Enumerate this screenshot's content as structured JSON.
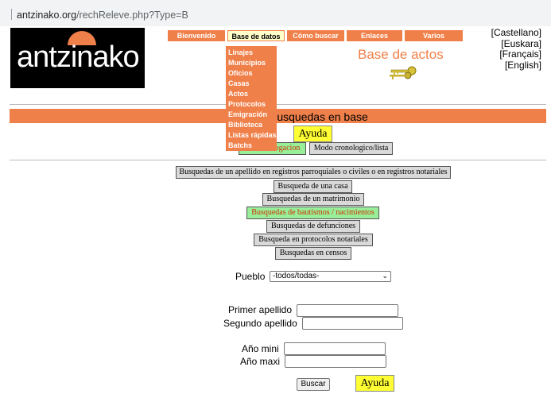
{
  "browser": {
    "url_domain": "antzinako.org",
    "url_path": "/rechReleve.php?Type=B"
  },
  "logo": {
    "text": "antzinako"
  },
  "nav": {
    "items": [
      "Bienvenido",
      "Base de datos",
      "Cómo buscar",
      "Enlaces",
      "Varios"
    ],
    "active": "Base de datos"
  },
  "dropdown": {
    "items": [
      "Linajes",
      "Municipios",
      "Oficios",
      "Casas",
      "Actos",
      "Protocolos",
      "Emigración",
      "Biblioteca",
      "Listas rápidas",
      "Batchs"
    ]
  },
  "languages": [
    "[Castellano]",
    "[Euskara]",
    "[Français]",
    "[English]"
  ],
  "section_title": "Base de actos",
  "banner_text": "Busquedas en base",
  "help_label": "Ayuda",
  "mode_buttons": {
    "interrogation": "Modo interrogacion",
    "interrogation_visible": "ogacion",
    "chrono": "Modo cronologico/lista"
  },
  "searches": [
    "Busquedas de un apellido en registros parroquiales o civiles o en registros notariales",
    "Busqueda de una casa",
    "Busquedas de un matrimonio",
    "Busquedas de bautismos / nacimientos",
    "Busquedas de defunciones",
    "Busqueda en protocolos notariales",
    "Busquedas en censos"
  ],
  "active_search": "Busquedas de bautismos / nacimientos",
  "form": {
    "pueblo_label": "Pueblo",
    "pueblo_value": "-todos/todas-",
    "primer_apellido_label": "Primer apellido",
    "segundo_apellido_label": "Segundo apellido",
    "ano_mini_label": "Año mini",
    "ano_maxi_label": "Año maxi",
    "buscar_label": "Buscar"
  },
  "colors": {
    "accent": "#f0804a",
    "help_bg": "#ffff33",
    "active_search_bg": "#99ee99",
    "active_search_text": "#cc3300"
  }
}
